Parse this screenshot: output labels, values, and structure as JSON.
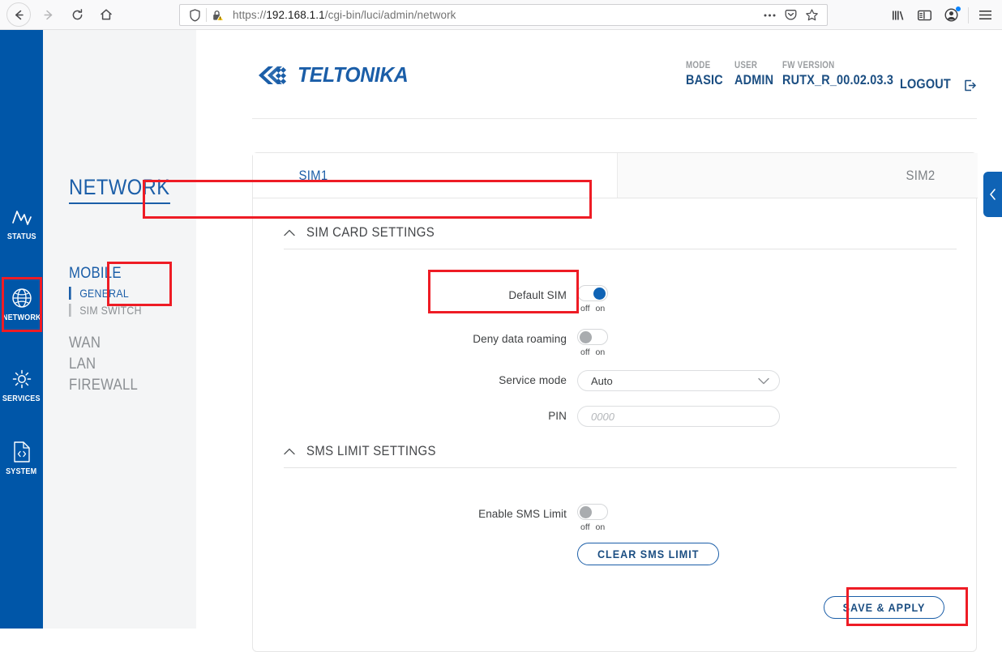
{
  "browser": {
    "back_icon": "back-arrow-icon",
    "forward_icon": "forward-arrow-icon",
    "reload_icon": "reload-icon",
    "home_icon": "home-icon",
    "shield_icon": "shield-icon",
    "lock_warning_icon": "lock-warning-icon",
    "url_host": "192.168.1.1",
    "url_path": "/cgi-bin/luci/admin/network",
    "url_scheme": "https://",
    "url_full": "https://192.168.1.1/cgi-bin/luci/admin/network",
    "page_actions_icon": "ellipsis-icon",
    "pocket_icon": "pocket-icon",
    "bookmark_star_icon": "star-icon",
    "library_icon": "library-icon",
    "sidebar_icon": "sidebar-icon",
    "account_icon": "account-icon",
    "menu_icon": "hamburger-menu-icon"
  },
  "rail": {
    "items": [
      {
        "label": "STATUS",
        "icon": "pulse-chart-icon",
        "active": false
      },
      {
        "label": "NETWORK",
        "icon": "globe-icon",
        "active": true
      },
      {
        "label": "SERVICES",
        "icon": "gear-icon",
        "active": false
      },
      {
        "label": "SYSTEM",
        "icon": "code-file-icon",
        "active": false
      }
    ]
  },
  "menu": {
    "title": "NETWORK",
    "groups": [
      {
        "label": "MOBILE",
        "items": [
          {
            "label": "GENERAL",
            "active": true
          },
          {
            "label": "SIM SWITCH",
            "active": false
          }
        ]
      }
    ],
    "links": [
      {
        "label": "WAN"
      },
      {
        "label": "LAN"
      },
      {
        "label": "FIREWALL"
      }
    ]
  },
  "header": {
    "logo_text": "TELTONIKA",
    "info": [
      {
        "caption": "MODE",
        "value": "BASIC"
      },
      {
        "caption": "USER",
        "value": "ADMIN"
      },
      {
        "caption": "FW VERSION",
        "value": "RUTX_R_00.02.03.3"
      }
    ],
    "logout_label": "LOGOUT",
    "logout_icon": "logout-icon"
  },
  "tabs": [
    {
      "label": "SIM1",
      "active": true
    },
    {
      "label": "SIM2",
      "active": false
    }
  ],
  "sections": [
    {
      "title": "SIM CARD SETTINGS",
      "collapse_icon": "chevron-up-icon"
    },
    {
      "title": "SMS LIMIT SETTINGS",
      "collapse_icon": "chevron-up-icon"
    }
  ],
  "fields": {
    "default_sim": {
      "label": "Default SIM",
      "state": "on",
      "off_label": "off",
      "on_label": "on"
    },
    "deny_roaming": {
      "label": "Deny data roaming",
      "state": "off",
      "off_label": "off",
      "on_label": "on"
    },
    "service_mode": {
      "label": "Service mode",
      "value": "Auto",
      "chevron_icon": "chevron-down-icon"
    },
    "pin": {
      "label": "PIN",
      "value": "",
      "placeholder": "0000"
    },
    "enable_sms_limit": {
      "label": "Enable SMS Limit",
      "state": "off",
      "off_label": "off",
      "on_label": "on"
    }
  },
  "buttons": {
    "clear_sms_limit": "CLEAR SMS LIMIT",
    "save_apply": "SAVE & APPLY"
  },
  "edge_tab": {
    "icon": "chevron-left-icon"
  },
  "colors": {
    "brand_blue": "#0056a8",
    "link_blue": "#1b5ea8",
    "accent_blue": "#0f63b5",
    "highlight_red": "#ee1c25",
    "muted_gray": "#8b8f93"
  }
}
